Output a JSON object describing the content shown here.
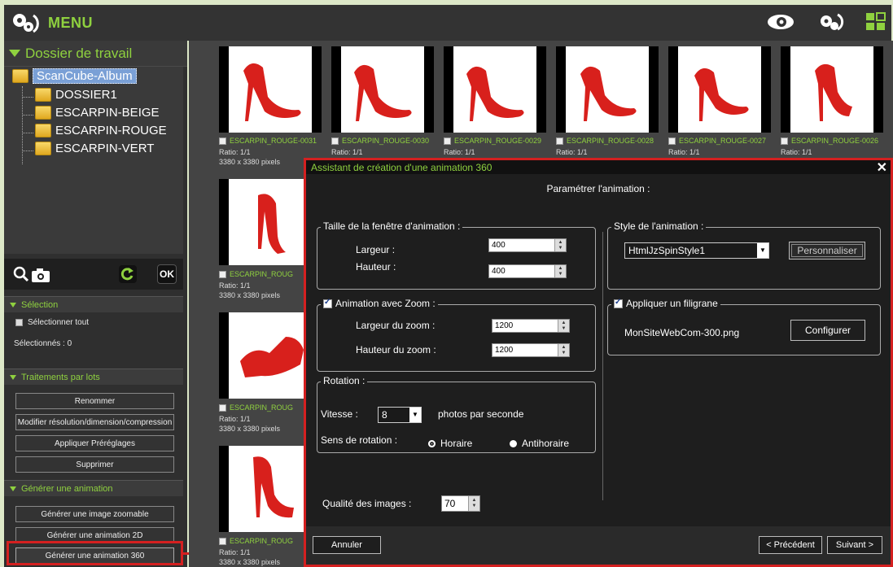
{
  "topbar": {
    "menu_label": "MENU",
    "icons": [
      "gears-icon",
      "eye-icon",
      "gear-refresh-icon",
      "grid-layout-icon"
    ]
  },
  "sidebar": {
    "dossier_title": "Dossier de travail",
    "tree": {
      "root": "ScanCube-Album",
      "children": [
        "DOSSIER1",
        "ESCARPIN-BEIGE",
        "ESCARPIN-ROUGE",
        "ESCARPIN-VERT"
      ]
    },
    "toolbar": {
      "ok_label": "OK"
    },
    "selection": {
      "title": "Sélection",
      "select_all": "Sélectionner tout",
      "selected_count": "Sélectionnés :   0"
    },
    "batch": {
      "title": "Traitements par lots",
      "buttons": [
        "Renommer",
        "Modifier résolution/dimension/compression",
        "Appliquer Préréglages",
        "Supprimer"
      ]
    },
    "animation": {
      "title": "Générer une animation",
      "buttons": [
        "Générer une image zoomable",
        "Générer une animation 2D",
        "Générer une animation 360"
      ]
    }
  },
  "grid": {
    "ratio": "Ratio: 1/1",
    "ratio_cut": "Ratio: 1/1",
    "size": "3380 x 3380 pixels",
    "top_row": [
      "ESCARPIN_ROUGE-0031",
      "ESCARPIN_ROUGE-0030",
      "ESCARPIN_ROUGE-0029",
      "ESCARPIN_ROUGE-0028",
      "ESCARPIN_ROUGE-0027",
      "ESCARPIN_ROUGE-0026"
    ],
    "left_col_labels": [
      "ESCARPIN_ROUG",
      "ESCARPIN_ROUG",
      "ESCARPIN_ROUG"
    ],
    "accent": "#8fd13f"
  },
  "dialog": {
    "title": "Assistant de création d'une animation 360",
    "subtitle": "Paramétrer l'animation :",
    "window_size": {
      "legend": "Taille de la fenêtre d'animation :",
      "width_label": "Largeur :",
      "width_value": "400",
      "height_label": "Hauteur :",
      "height_value": "400"
    },
    "zoom": {
      "legend": "Animation avec Zoom :",
      "checked": true,
      "width_label": "Largeur du zoom :",
      "width_value": "1200",
      "height_label": "Hauteur du zoom :",
      "height_value": "1200"
    },
    "rotation": {
      "legend": "Rotation :",
      "speed_label": "Vitesse :",
      "speed_value": "8",
      "speed_unit": "photos par seconde",
      "direction_label": "Sens de rotation :",
      "option_cw": "Horaire",
      "option_ccw": "Antihoraire",
      "selected": "Horaire"
    },
    "quality": {
      "label": "Qualité des images :",
      "value": "70"
    },
    "style": {
      "legend": "Style de l'animation :",
      "selected": "HtmlJzSpinStyle1",
      "customize_button": "Personnaliser"
    },
    "watermark": {
      "legend": "Appliquer un filigrane",
      "checked": true,
      "file": "MonSiteWebCom-300.png",
      "configure_button": "Configurer"
    },
    "footer": {
      "cancel": "Annuler",
      "previous": "< Précédent",
      "next": "Suivant >"
    },
    "highlight_color": "#d42020"
  }
}
